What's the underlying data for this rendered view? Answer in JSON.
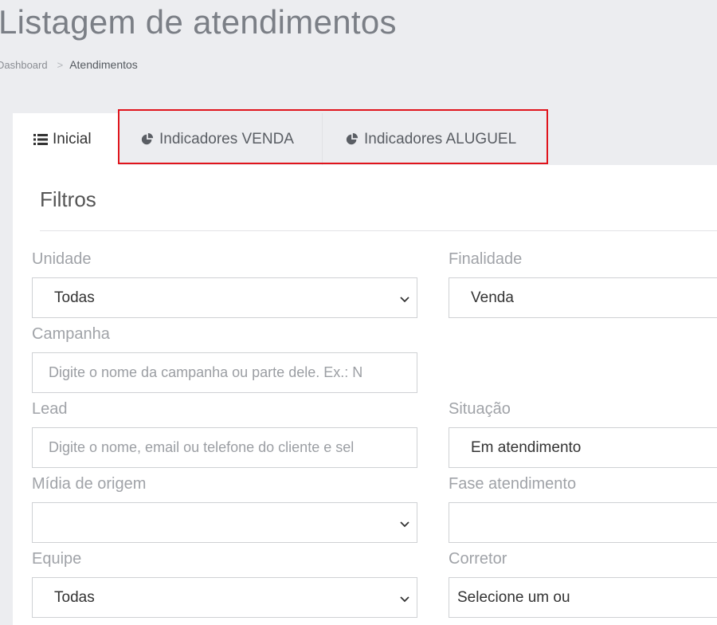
{
  "header": {
    "title": "Listagem de atendimentos",
    "breadcrumb": {
      "home": "Dashboard",
      "separator": ">",
      "current": "Atendimentos"
    }
  },
  "tabs": [
    {
      "label": "Inicial",
      "icon": "list-icon",
      "active": true
    },
    {
      "label": "Indicadores VENDA",
      "icon": "pie-chart-icon",
      "active": false
    },
    {
      "label": "Indicadores ALUGUEL",
      "icon": "pie-chart-icon",
      "active": false
    }
  ],
  "panel": {
    "title": "Filtros"
  },
  "filters": {
    "unidade": {
      "label": "Unidade",
      "value": "Todas"
    },
    "finalidade": {
      "label": "Finalidade",
      "value": "Venda"
    },
    "campanha": {
      "label": "Campanha",
      "placeholder": "Digite o nome da campanha ou parte dele. Ex.: N"
    },
    "lead": {
      "label": "Lead",
      "placeholder": "Digite o nome, email ou telefone do cliente e sel"
    },
    "situacao": {
      "label": "Situação",
      "value": "Em atendimento"
    },
    "midia": {
      "label": "Mídia de origem",
      "value": ""
    },
    "fase": {
      "label": "Fase atendimento",
      "value": ""
    },
    "equipe": {
      "label": "Equipe",
      "value": "Todas"
    },
    "corretor": {
      "label": "Corretor",
      "value": "Selecione um ou"
    }
  },
  "colors": {
    "highlight": "#e0141c",
    "background": "#ecedf0",
    "panel": "#ffffff"
  }
}
